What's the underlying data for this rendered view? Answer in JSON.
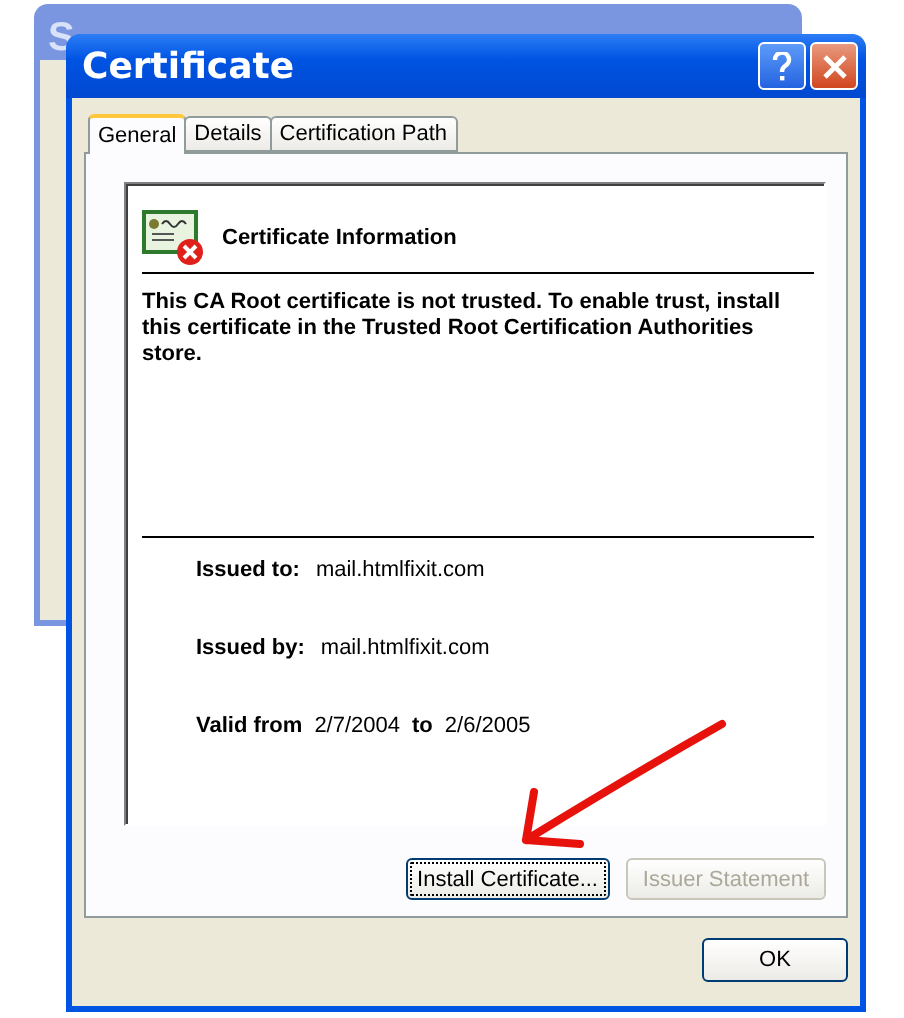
{
  "background_window": {
    "title": "S",
    "active": false
  },
  "window": {
    "title": "Certificate",
    "active": true
  },
  "tabs": [
    {
      "label": "General",
      "selected": true
    },
    {
      "label": "Details",
      "selected": false
    },
    {
      "label": "Certification Path",
      "selected": false
    }
  ],
  "certificate_info": {
    "heading": "Certificate Information",
    "trusted": false,
    "message": "This CA Root certificate is not trusted. To enable trust, install this certificate in the Trusted Root Certification Authorities store."
  },
  "issued_to": {
    "label": "Issued to:",
    "value": "mail.htmlfixit.com"
  },
  "issued_by": {
    "label": "Issued by:",
    "value": "mail.htmlfixit.com"
  },
  "validity": {
    "from_label": "Valid from",
    "from": "2/7/2004",
    "to_label": "to",
    "to": "2/6/2005"
  },
  "panel_buttons": [
    {
      "label": "Install Certificate...",
      "disabled": false,
      "focused": true
    },
    {
      "label": "Issuer Statement",
      "disabled": true,
      "focused": false
    }
  ],
  "ok_button": {
    "label": "OK"
  }
}
